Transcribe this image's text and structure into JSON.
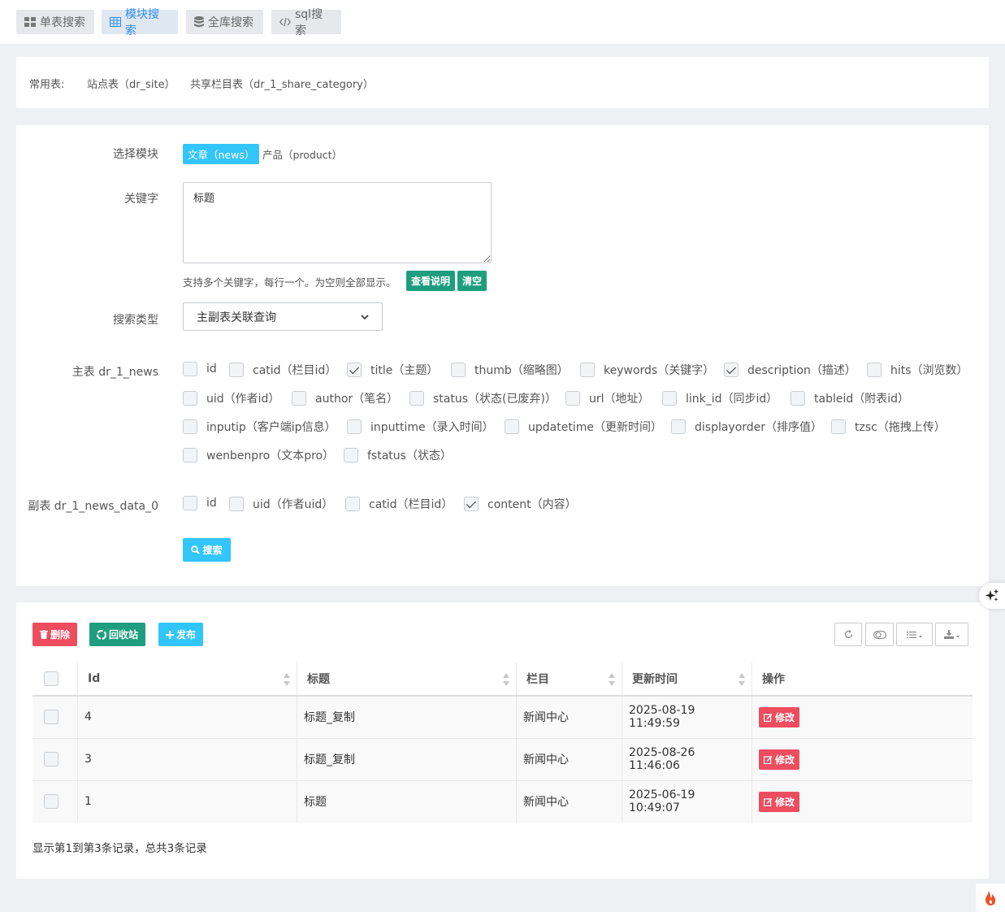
{
  "tabs": [
    {
      "label": "单表搜索",
      "icon": "grid-icon"
    },
    {
      "label": "模块搜索",
      "icon": "table-icon"
    },
    {
      "label": "全库搜索",
      "icon": "database-icon"
    },
    {
      "label": "sql搜索",
      "icon": "code-icon"
    }
  ],
  "quick": {
    "label": "常用表:",
    "links": [
      "站点表（dr_site）",
      "共享栏目表（dr_1_share_category）"
    ]
  },
  "form": {
    "module_label": "选择模块",
    "modules": [
      "文章（news）",
      "产品（product）"
    ],
    "keyword_label": "关键字",
    "keyword_value": "标题",
    "keyword_help": "支持多个关键字，每行一个。为空则全部显示。",
    "help_btn": "查看说明",
    "clear_btn": "清空",
    "type_label": "搜索类型",
    "type_value": "主副表关联查询",
    "main_label": "主表 dr_1_news",
    "main_fields": [
      {
        "label": "id",
        "checked": false
      },
      {
        "label": "catid（栏目id）",
        "checked": false
      },
      {
        "label": "title（主题）",
        "checked": true
      },
      {
        "label": "thumb（缩略图）",
        "checked": false
      },
      {
        "label": "keywords（关键字）",
        "checked": false
      },
      {
        "label": "description（描述）",
        "checked": true
      },
      {
        "label": "hits（浏览数）",
        "checked": false
      },
      {
        "label": "uid（作者id）",
        "checked": false
      },
      {
        "label": "author（笔名）",
        "checked": false
      },
      {
        "label": "status（状态(已废弃)）",
        "checked": false
      },
      {
        "label": "url（地址）",
        "checked": false
      },
      {
        "label": "link_id（同步id）",
        "checked": false
      },
      {
        "label": "tableid（附表id）",
        "checked": false
      },
      {
        "label": "inputip（客户端ip信息）",
        "checked": false
      },
      {
        "label": "inputtime（录入时间）",
        "checked": false
      },
      {
        "label": "updatetime（更新时间）",
        "checked": false
      },
      {
        "label": "displayorder（排序值）",
        "checked": false
      },
      {
        "label": "tzsc（拖拽上传）",
        "checked": false
      },
      {
        "label": "wenbenpro（文本pro）",
        "checked": false
      },
      {
        "label": "fstatus（状态）",
        "checked": false
      }
    ],
    "sub_label": "副表 dr_1_news_data_0",
    "sub_fields": [
      {
        "label": "id",
        "checked": false
      },
      {
        "label": "uid（作者uid）",
        "checked": false
      },
      {
        "label": "catid（栏目id）",
        "checked": false
      },
      {
        "label": "content（内容）",
        "checked": true
      }
    ],
    "search_btn": "搜索"
  },
  "actions": {
    "delete": "删除",
    "recycle": "回收站",
    "publish": "发布"
  },
  "table": {
    "headers": [
      "Id",
      "标题",
      "栏目",
      "更新时间",
      "操作"
    ],
    "rows": [
      {
        "id": "4",
        "title": "标题_复制",
        "category": "新闻中心",
        "time": "2025-08-19 11:49:59",
        "action": "修改"
      },
      {
        "id": "3",
        "title": "标题_复制",
        "category": "新闻中心",
        "time": "2025-08-26 11:46:06",
        "action": "修改"
      },
      {
        "id": "1",
        "title": "标题",
        "category": "新闻中心",
        "time": "2025-06-19 10:49:07",
        "action": "修改"
      }
    ],
    "summary": "显示第1到第3条记录，总共3条记录"
  },
  "colors": {
    "accent": "#32c5fa",
    "green": "#1e9e7e",
    "red": "#ed4d5f"
  }
}
